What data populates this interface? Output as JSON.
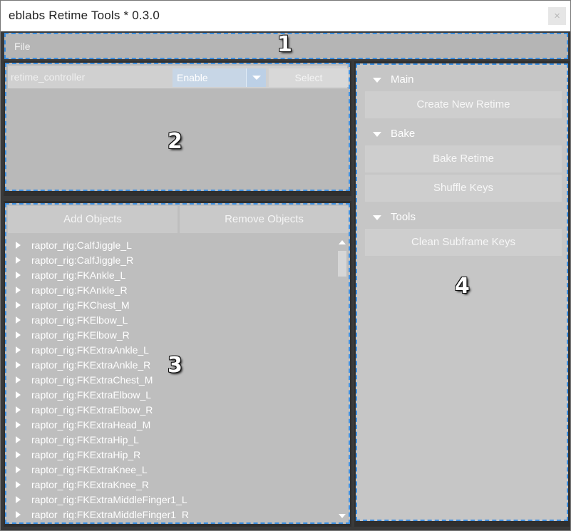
{
  "window": {
    "title": "eblabs Retime Tools * 0.3.0",
    "close_glyph": "×"
  },
  "menubar": {
    "file_label": "File"
  },
  "annotations": [
    "1",
    "2",
    "3",
    "4"
  ],
  "controller": {
    "name": "retime_controller",
    "mode_value": "Enable",
    "select_label": "Select"
  },
  "objects": {
    "add_label": "Add Objects",
    "remove_label": "Remove Objects",
    "items": [
      "raptor_rig:CalfJiggle_L",
      "raptor_rig:CalfJiggle_R",
      "raptor_rig:FKAnkle_L",
      "raptor_rig:FKAnkle_R",
      "raptor_rig:FKChest_M",
      "raptor_rig:FKElbow_L",
      "raptor_rig:FKElbow_R",
      "raptor_rig:FKExtraAnkle_L",
      "raptor_rig:FKExtraAnkle_R",
      "raptor_rig:FKExtraChest_M",
      "raptor_rig:FKExtraElbow_L",
      "raptor_rig:FKExtraElbow_R",
      "raptor_rig:FKExtraHead_M",
      "raptor_rig:FKExtraHip_L",
      "raptor_rig:FKExtraHip_R",
      "raptor_rig:FKExtraKnee_L",
      "raptor_rig:FKExtraKnee_R",
      "raptor_rig:FKExtraMiddleFinger1_L",
      "raptor_rig:FKExtraMiddleFinger1_R"
    ]
  },
  "tools_panel": {
    "sections": [
      {
        "label": "Main",
        "buttons": [
          "Create New Retime"
        ]
      },
      {
        "label": "Bake",
        "buttons": [
          "Bake Retime",
          "Shuffle Keys"
        ]
      },
      {
        "label": "Tools",
        "buttons": [
          "Clean Subframe Keys"
        ]
      }
    ]
  },
  "colors": {
    "accent_dash": "#3b8ee0",
    "combo_bg": "#c7d6e6"
  }
}
